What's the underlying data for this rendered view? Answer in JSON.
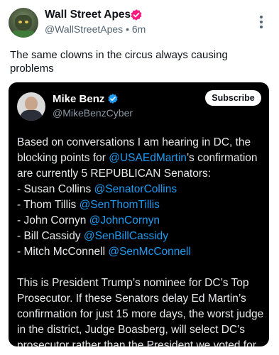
{
  "post": {
    "author_name": "Wall Street Apes",
    "handle": "@WallStreetApes",
    "separator": "•",
    "time": "6m",
    "text_line1": "The same clowns in the circus always causing",
    "text_line2": "problems"
  },
  "quote": {
    "author_name": "Mike Benz",
    "handle": "@MikeBenzCyber",
    "subscribe_label": "Subscribe",
    "line1": "Based on conversations I am hearing in DC, the",
    "line2_pre": "blocking points for ",
    "line2_mention": "@USAEdMartin",
    "line2_post": "’s confirmation",
    "line3": "are currently 5 REPUBLICAN Senators:",
    "senators": [
      {
        "name": "- Susan Collins ",
        "mention": "@SenatorCollins"
      },
      {
        "name": "- Thom Tillis ",
        "mention": "@SenThomTillis"
      },
      {
        "name": "- John Cornyn ",
        "mention": "@JohnCornyn"
      },
      {
        "name": "- Bill Cassidy ",
        "mention": "@SenBillCassidy"
      },
      {
        "name": "- Mitch McConnell ",
        "mention": "@SenMcConnell"
      }
    ],
    "para2": [
      "This is President Trump’s nominee for DC’s Top",
      "Prosecutor. If these Senators delay Ed Martin’s",
      "confirmation for just 15 more days, the worst judge",
      "in the district, Judge Boasberg, will select DC’s",
      "prosecutor rather than the President we voted for."
    ]
  },
  "colors": {
    "link": "#1d9bf0",
    "verified_outer": "#f91880",
    "verified_inner": "#1d9bf0",
    "quote_bg": "#000000"
  },
  "icons": {
    "verified": "verified-badge-icon",
    "more": "more-vertical-icon"
  }
}
